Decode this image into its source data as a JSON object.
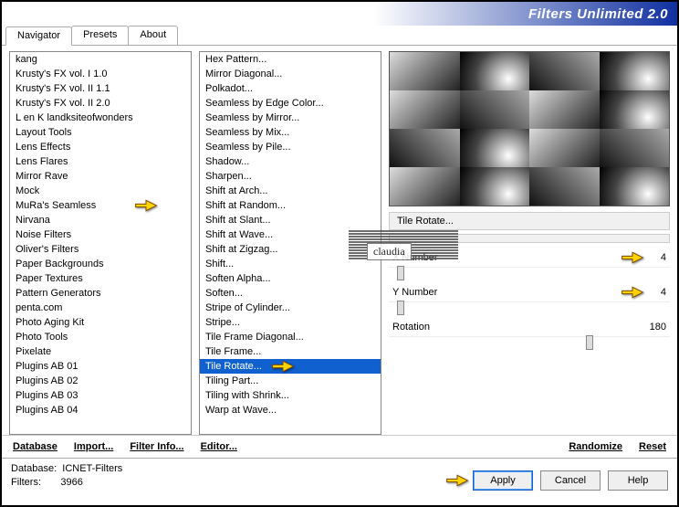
{
  "title": "Filters Unlimited 2.0",
  "tabs": [
    "Navigator",
    "Presets",
    "About"
  ],
  "active_tab": 0,
  "list1": {
    "items": [
      "kang",
      "Krusty's FX vol. I 1.0",
      "Krusty's FX vol. II 1.1",
      "Krusty's FX vol. II 2.0",
      "L en K landksiteofwonders",
      "Layout Tools",
      "Lens Effects",
      "Lens Flares",
      "Mirror Rave",
      "Mock",
      "MuRa's Seamless",
      "Nirvana",
      "Noise Filters",
      "Oliver's Filters",
      "Paper Backgrounds",
      "Paper Textures",
      "Pattern Generators",
      "penta.com",
      "Photo Aging Kit",
      "Photo Tools",
      "Pixelate",
      "Plugins AB 01",
      "Plugins AB 02",
      "Plugins AB 03",
      "Plugins AB 04"
    ],
    "highlight_index": 10
  },
  "list2": {
    "items": [
      "Hex Pattern...",
      "Mirror Diagonal...",
      "Polkadot...",
      "Seamless by Edge Color...",
      "Seamless by Mirror...",
      "Seamless by Mix...",
      "Seamless by Pile...",
      "Shadow...",
      "Sharpen...",
      "Shift at Arch...",
      "Shift at Random...",
      "Shift at Slant...",
      "Shift at Wave...",
      "Shift at Zigzag...",
      "Shift...",
      "Soften Alpha...",
      "Soften...",
      "Stripe of Cylinder...",
      "Stripe...",
      "Tile Frame Diagonal...",
      "Tile Frame...",
      "Tile Rotate...",
      "Tiling Part...",
      "Tiling with Shrink...",
      "Warp at Wave..."
    ],
    "selected_index": 21
  },
  "filter_name": "Tile Rotate...",
  "params": [
    {
      "label": "X Number",
      "value": "4",
      "pos": 3
    },
    {
      "label": "Y Number",
      "value": "4",
      "pos": 3
    },
    {
      "label": "Rotation",
      "value": "180",
      "pos": 70
    }
  ],
  "row_buttons_left": [
    "Database",
    "Import...",
    "Filter Info...",
    "Editor..."
  ],
  "row_buttons_right": [
    "Randomize",
    "Reset"
  ],
  "dialog_buttons": [
    "Apply",
    "Cancel",
    "Help"
  ],
  "status": {
    "db_label": "Database:",
    "db_val": "ICNET-Filters",
    "flt_label": "Filters:",
    "flt_val": "3966"
  },
  "watermark_text": "claudia"
}
